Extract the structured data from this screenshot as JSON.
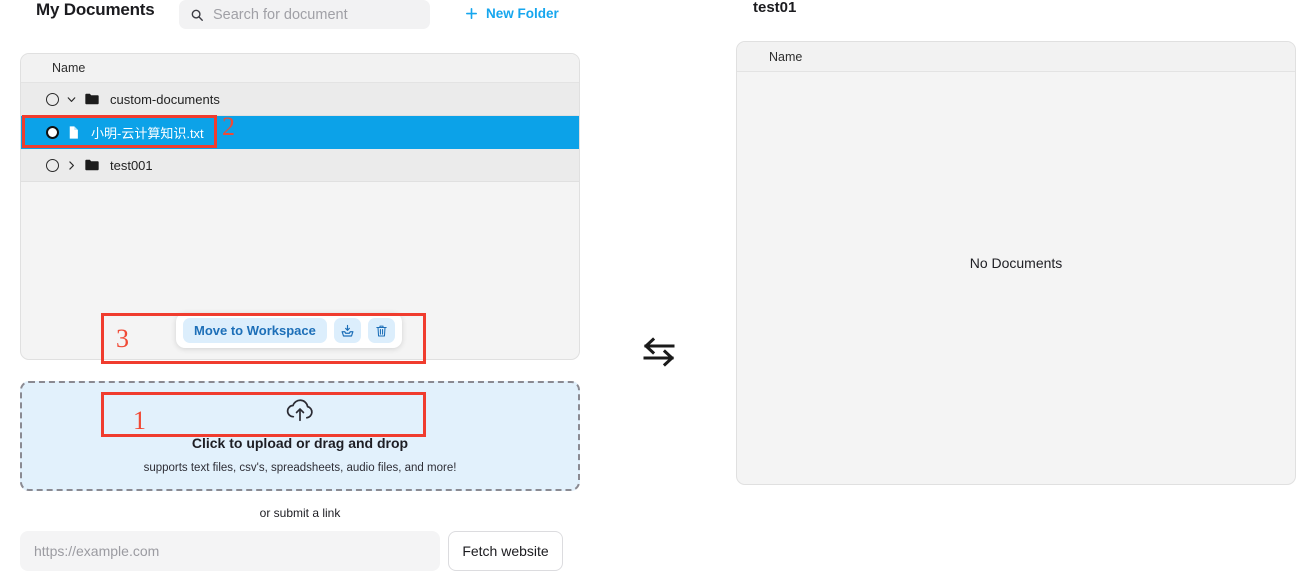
{
  "left_pane": {
    "title": "My Documents",
    "search": {
      "placeholder": "Search for document",
      "value": "",
      "icon": "search-icon"
    },
    "new_folder": {
      "label": "New Folder",
      "icon": "plus-icon",
      "color": "#16a6ee"
    },
    "file_list": {
      "column_header": "Name",
      "rows": [
        {
          "label": "custom-documents",
          "type": "folder",
          "expanded": true,
          "chevron": "chevron-down-icon",
          "checked": false,
          "selected": false,
          "indent": 0
        },
        {
          "label": "小明-云计算知识.txt",
          "type": "file",
          "expanded": false,
          "chevron": "",
          "checked": true,
          "selected": true,
          "indent": 1
        },
        {
          "label": "test001",
          "type": "folder",
          "expanded": false,
          "chevron": "chevron-right-icon",
          "checked": false,
          "selected": false,
          "indent": 0
        }
      ],
      "selected_row_color": "#0ca2e8"
    },
    "action_bar": {
      "move_label": "Move to Workspace",
      "download_icon": "download-to-folder-icon",
      "delete_icon": "trash-icon",
      "pill_bg": "#dceefc",
      "pill_text": "#1d6fb8"
    },
    "dropzone": {
      "icon": "cloud-upload-icon",
      "primary": "Click to upload or drag and drop",
      "secondary": "supports text files, csv's, spreadsheets, audio files, and more!",
      "bg": "#e2f1fc"
    },
    "submit_link": {
      "label": "or submit a link",
      "url_placeholder": "https://example.com",
      "url_value": "",
      "fetch_label": "Fetch website"
    }
  },
  "swap": {
    "icon": "swap-horizontal-arrows-icon"
  },
  "right_pane": {
    "title": "test01",
    "column_header": "Name",
    "empty_state": "No Documents"
  },
  "annotations": {
    "color": "#f03c2e",
    "markers": [
      {
        "number": "1",
        "target": "upload-dropzone-click-area"
      },
      {
        "number": "2",
        "target": "selected-file-row"
      },
      {
        "number": "3",
        "target": "action-bar"
      }
    ]
  }
}
